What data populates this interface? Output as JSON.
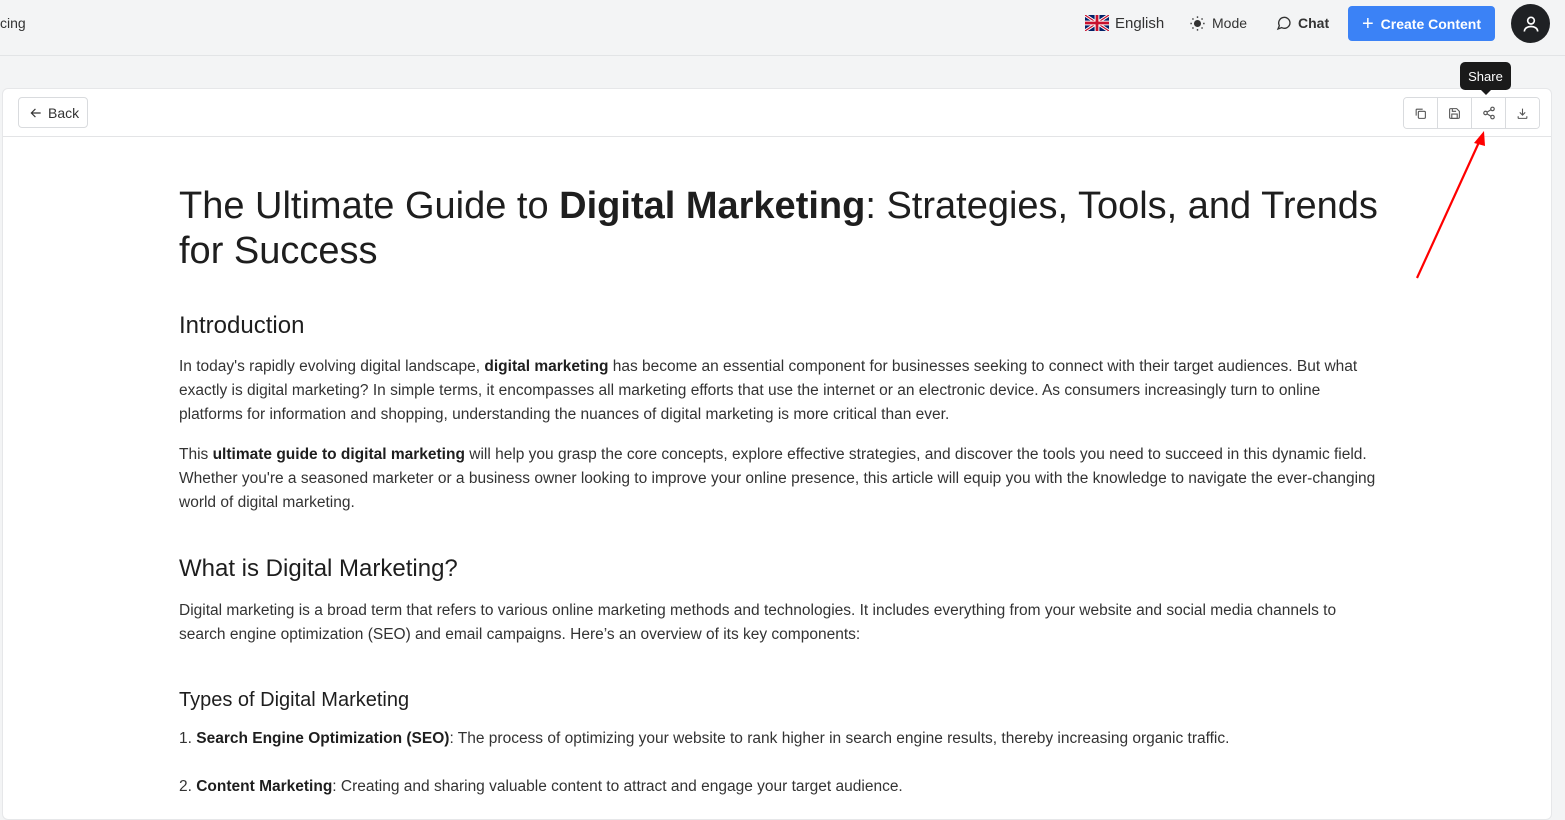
{
  "topbar": {
    "crumb": "cing",
    "language": "English",
    "mode": "Mode",
    "chat": "Chat",
    "create": "Create Content"
  },
  "toolbar": {
    "back": "Back",
    "tooltip": "Share"
  },
  "article": {
    "title_pre": "The Ultimate Guide to ",
    "title_bold": "Digital Marketing",
    "title_post": ": Strategies, Tools, and Trends for Success",
    "intro_heading": "Introduction",
    "p1_pre": "In today's rapidly evolving digital landscape, ",
    "p1_bold": "digital marketing",
    "p1_post": " has become an essential component for businesses seeking to connect with their target audiences. But what exactly is digital marketing? In simple terms, it encompasses all marketing efforts that use the internet or an electronic device. As consumers increasingly turn to online platforms for information and shopping, understanding the nuances of digital marketing is more critical than ever.",
    "p2_pre": "This ",
    "p2_bold": "ultimate guide to digital marketing",
    "p2_post": " will help you grasp the core concepts, explore effective strategies, and discover the tools you need to succeed in this dynamic field. Whether you're a seasoned marketer or a business owner looking to improve your online presence, this article will equip you with the knowledge to navigate the ever-changing world of digital marketing.",
    "what_heading": "What is Digital Marketing?",
    "p3": "Digital marketing is a broad term that refers to various online marketing methods and technologies. It includes everything from your website and social media channels to search engine optimization (SEO) and email campaigns. Here’s an overview of its key components:",
    "types_heading": "Types of Digital Marketing",
    "items": [
      {
        "num": "1. ",
        "bold": "Search Engine Optimization (SEO)",
        "text": ": The process of optimizing your website to rank higher in search engine results, thereby increasing organic traffic."
      },
      {
        "num": "2. ",
        "bold": "Content Marketing",
        "text": ": Creating and sharing valuable content to attract and engage your target audience."
      }
    ]
  },
  "colors": {
    "accent": "#3b82f6",
    "annotation_arrow": "#ff0000",
    "tooltip_bg": "#1a1a1a"
  }
}
